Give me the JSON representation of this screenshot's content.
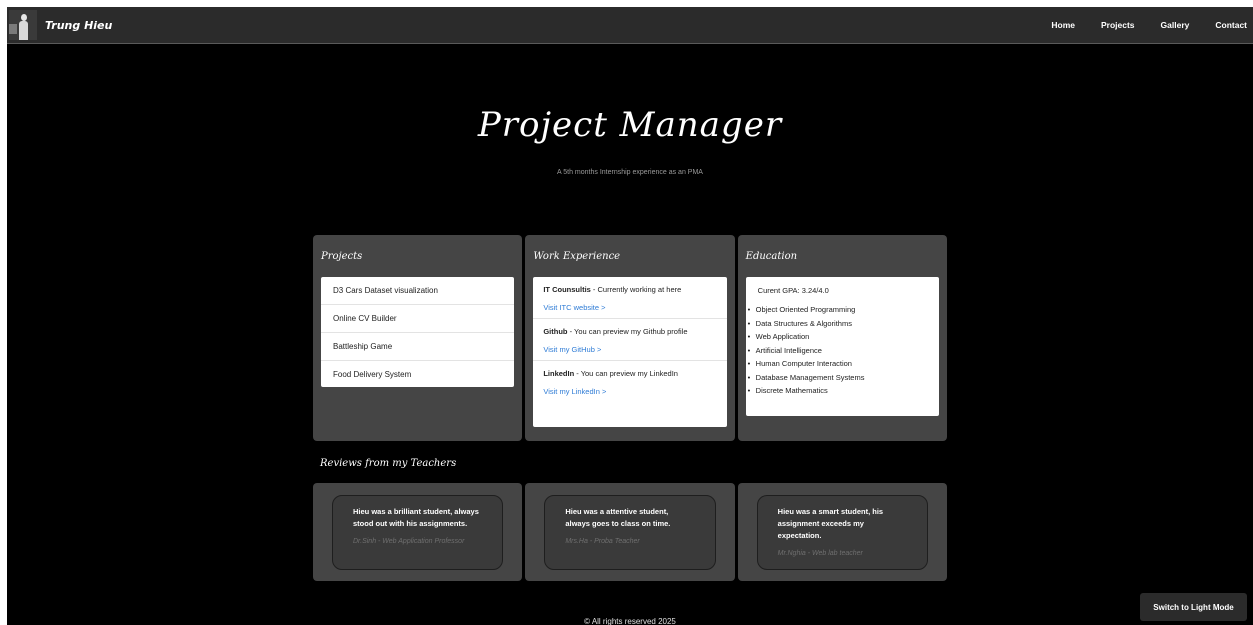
{
  "brand": {
    "name": "Trung Hieu"
  },
  "nav": {
    "items": [
      "Home",
      "Projects",
      "Gallery",
      "Contact"
    ]
  },
  "hero": {
    "title": "Project Manager",
    "subtitle": "A 5th months Internship experience as an PMA"
  },
  "projects": {
    "title": "Projects",
    "items": [
      "D3 Cars Dataset visualization",
      "Online CV Builder",
      "Battleship Game",
      "Food Delivery System"
    ]
  },
  "work": {
    "title": "Work Experience",
    "items": [
      {
        "name": "IT Counsultis",
        "desc": " - Currently working at here",
        "link": "Visit ITC website >"
      },
      {
        "name": "Github",
        "desc": " - You can preview my Github profile",
        "link": "Visit my GitHub >"
      },
      {
        "name": "LinkedIn",
        "desc": " - You can preview my LinkedIn",
        "link": "Visit my LinkedIn >"
      }
    ]
  },
  "education": {
    "title": "Education",
    "gpa": "Curent GPA: 3.24/4.0",
    "courses": [
      "Object Oriented Programming",
      "Data Structures & Algorithms",
      "Web Application",
      "Artificial Intelligence",
      "Human Computer Interaction",
      "Database Management Systems",
      "Discrete Mathematics"
    ]
  },
  "reviews": {
    "title": "Reviews from my Teachers",
    "items": [
      {
        "text": "Hieu was a brilliant student, always stood out with his assignments.",
        "author": "Dr.Sinh - Web Application Professor"
      },
      {
        "text": "Hieu was a attentive student, always goes to class on time.",
        "author": "Mrs.Ha - Proba Teacher"
      },
      {
        "text": "Hieu was a smart student, his assignment exceeds my expectation.",
        "author": "Mr.Nghia - Web lab teacher"
      }
    ]
  },
  "footer": {
    "text": "© All rights reserved 2025"
  },
  "mode_toggle": {
    "label": "Switch to Light Mode"
  }
}
